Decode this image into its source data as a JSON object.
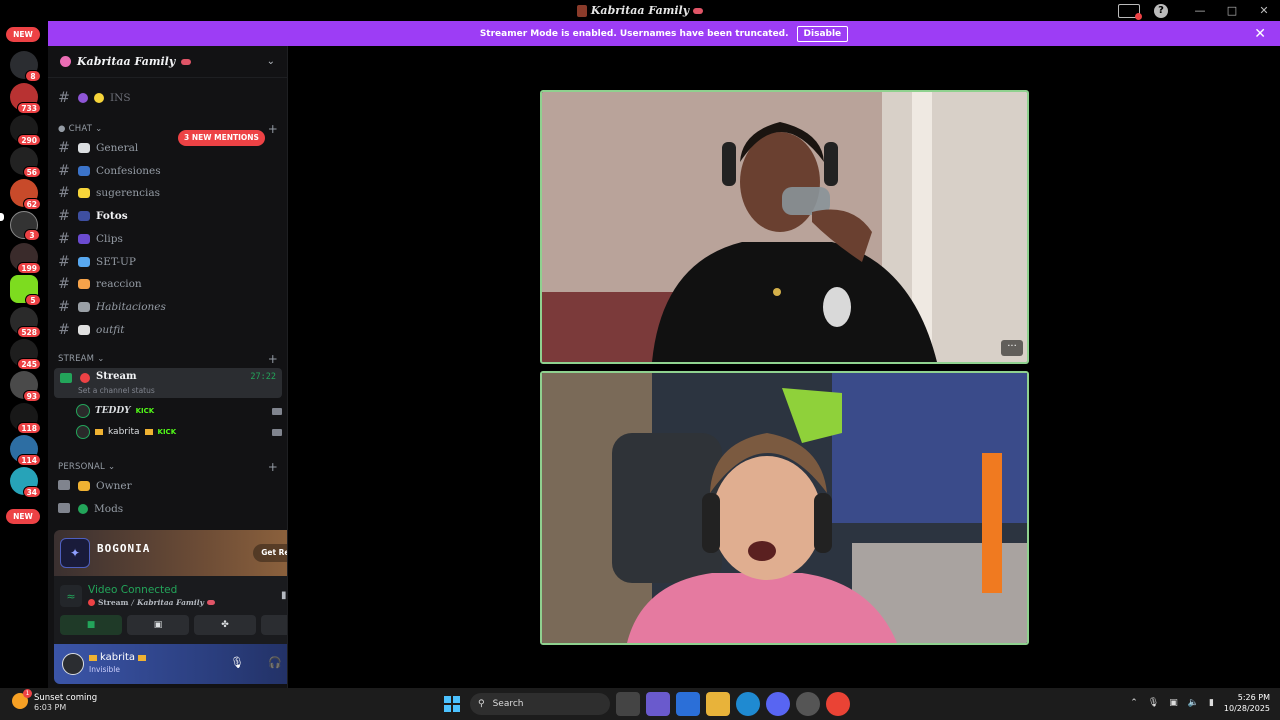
{
  "window": {
    "title": "Kabritaa Family"
  },
  "rail": {
    "new_top": "NEW",
    "new_bottom": "NEW",
    "badges": [
      "8",
      "733",
      "290",
      "56",
      "62",
      "3",
      "199",
      "5",
      "528",
      "245",
      "93",
      "118",
      "114",
      "34"
    ]
  },
  "banner": {
    "text": "Streamer Mode is enabled. Usernames have been truncated.",
    "button": "Disable"
  },
  "guild": {
    "name": "Kabritaa Family"
  },
  "mentions": "3 NEW MENTIONS",
  "partial_channel": "INS",
  "categories": {
    "chat": "CHAT",
    "stream": "STREAM",
    "personal": "PERSONAL"
  },
  "chat_channels": [
    {
      "label": "General",
      "bright": false,
      "color": "#dbdee1"
    },
    {
      "label": "Confesiones",
      "bright": false,
      "color": "#3b73c9"
    },
    {
      "label": "sugerencias",
      "bright": false,
      "color": "#f6d43a"
    },
    {
      "label": "Fotos",
      "bright": true,
      "color": "#3e4fa1"
    },
    {
      "label": "Clips",
      "bright": false,
      "color": "#6b4bd1"
    },
    {
      "label": "SET-UP",
      "bright": false,
      "color": "#58a8f0"
    },
    {
      "label": "reaccion",
      "bright": false,
      "color": "#f7a34a"
    },
    {
      "label": "Habitaciones",
      "bright": false,
      "color": "#9aa0a6"
    },
    {
      "label": "outfit",
      "bright": false,
      "color": "#e0e0e0"
    }
  ],
  "stream_channel": {
    "name": "Stream",
    "timer": "27:22",
    "status": "Set a channel status"
  },
  "voice_users": [
    {
      "name": "TEDDY",
      "tag": "KICK"
    },
    {
      "name": "kabrita",
      "tag": "KICK"
    }
  ],
  "personal_channels": [
    {
      "label": "Owner",
      "color": "#f0b232"
    },
    {
      "label": "Mods",
      "color": "#23a55a"
    }
  ],
  "promo": {
    "brand": "BOGONIA",
    "button": "Get Reward!"
  },
  "voice_panel": {
    "title": "Video Connected",
    "channel": "Stream",
    "separator": " / ",
    "server": "Kabritaa Family"
  },
  "user": {
    "name": "kabrita",
    "status": "Invisible"
  },
  "stream_tile": {
    "menu": "···"
  },
  "taskbar": {
    "weather_title": "Sunset coming",
    "weather_time": "6:03 PM",
    "search": "Search",
    "time": "5:26 PM",
    "date": "10/28/2025"
  }
}
